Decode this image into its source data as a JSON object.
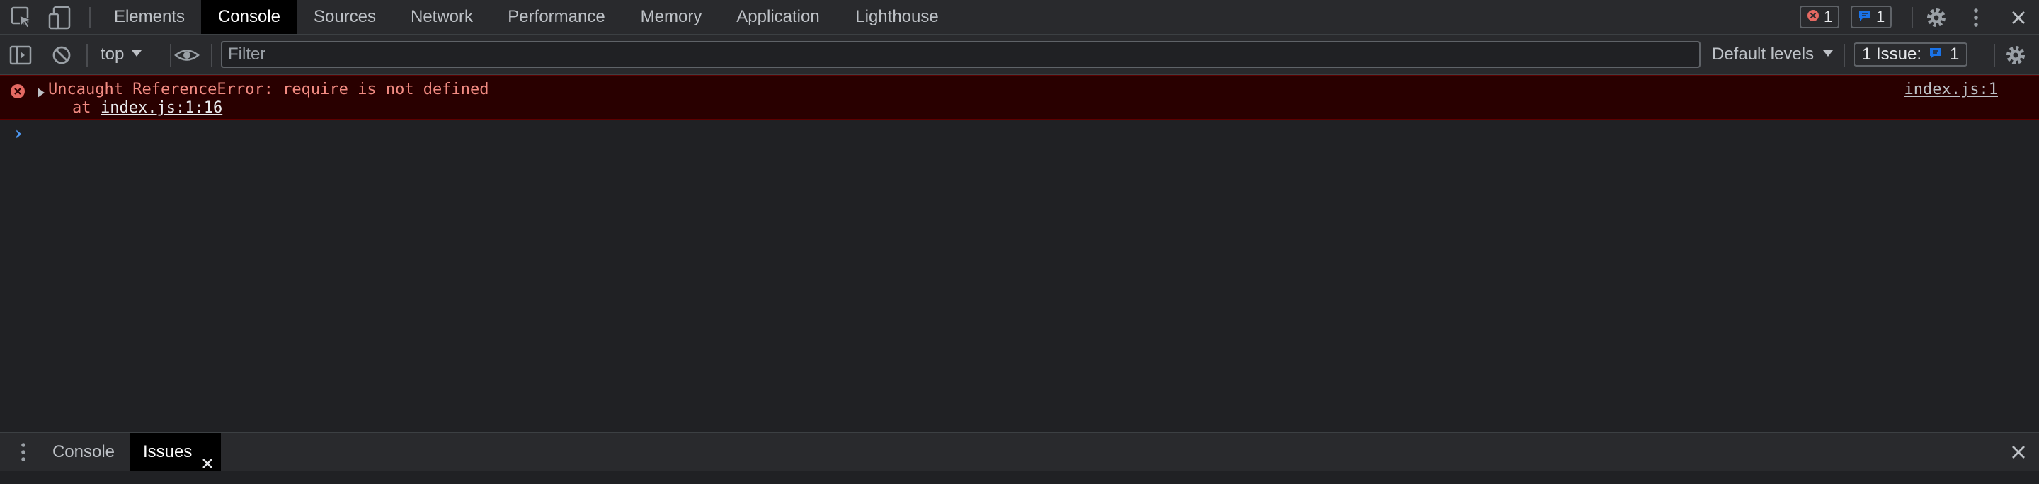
{
  "main_tabs": [
    {
      "label": "Elements"
    },
    {
      "label": "Console"
    },
    {
      "label": "Sources"
    },
    {
      "label": "Network"
    },
    {
      "label": "Performance"
    },
    {
      "label": "Memory"
    },
    {
      "label": "Application"
    },
    {
      "label": "Lighthouse"
    }
  ],
  "active_tab": "Console",
  "error_count": "1",
  "message_count": "1",
  "toolbar": {
    "context": "top",
    "filter_placeholder": "Filter",
    "levels": "Default levels",
    "issues_label": "1 Issue:",
    "issues_count": "1"
  },
  "error": {
    "message": "Uncaught ReferenceError: require is not defined",
    "stack_prefix": "at",
    "stack_link": "index.js:1:16",
    "source": "index.js:1"
  },
  "prompt": "›",
  "bottom_tabs": [
    {
      "label": "Console"
    },
    {
      "label": "Issues"
    }
  ],
  "colors": {
    "background": "#202124",
    "toolbar": "#292a2d",
    "error_bg": "#290000",
    "error_text": "#f28b82",
    "error_icon": "#e46962",
    "accent": "#1a73e8"
  }
}
